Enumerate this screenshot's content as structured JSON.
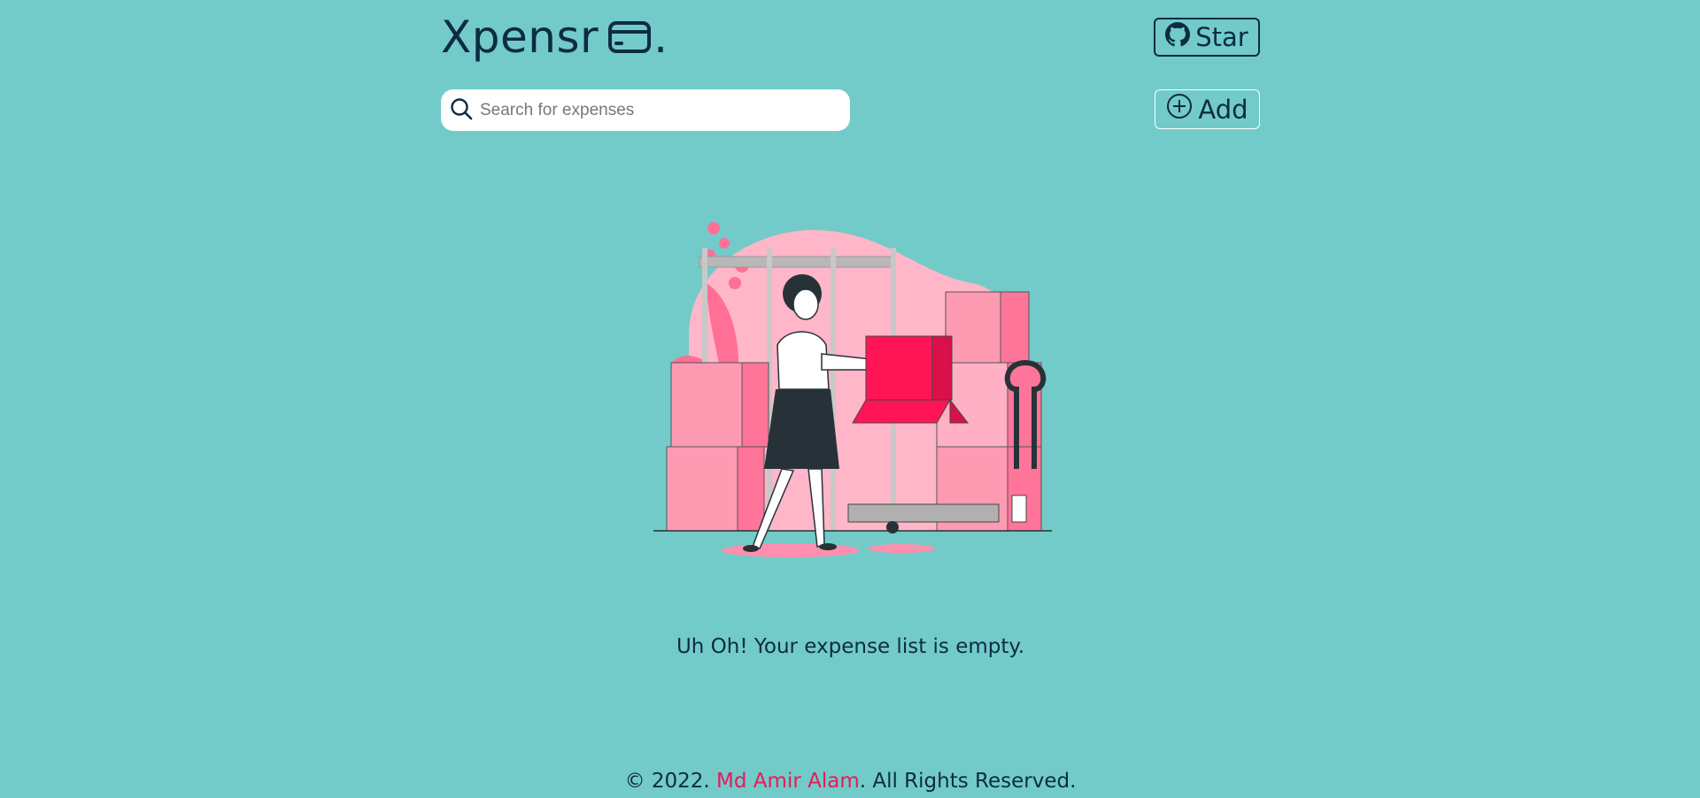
{
  "header": {
    "logo_text": "Xpensr",
    "logo_dot": ".",
    "logo_icon": "credit-card-icon",
    "star_label": "Star",
    "star_icon": "github-icon"
  },
  "search": {
    "placeholder": "Search for expenses",
    "value": "",
    "icon": "search-icon"
  },
  "add_button": {
    "label": "Add",
    "icon": "plus-circle-icon"
  },
  "empty_state": {
    "illustration": "woman-carrying-box-illustration",
    "message": "Uh Oh! Your expense list is empty."
  },
  "footer": {
    "prefix": "© 2022. ",
    "author": "Md Amir Alam",
    "suffix": ". All Rights Reserved."
  },
  "colors": {
    "background": "#72cbc8",
    "text": "#0d2b45",
    "accent": "#e8195a"
  }
}
